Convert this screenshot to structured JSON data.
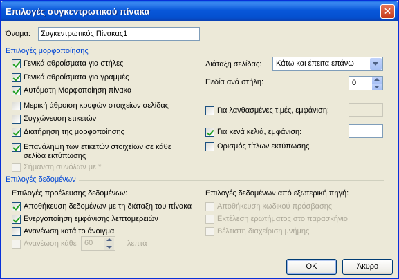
{
  "window": {
    "title": "Επιλογές συγκεντρωτικού πίνακα",
    "close_glyph": "✕"
  },
  "name": {
    "label": "Όνομα:",
    "value": "Συγκεντρωτικός Πίνακας1"
  },
  "format_section": {
    "title": "Επιλογές μορφοποίησης",
    "checkboxes": [
      {
        "label": "Γενικά αθροίσματα για στήλες",
        "checked": true
      },
      {
        "label": "Γενικά αθροίσματα για γραμμές",
        "checked": true
      },
      {
        "label": "Αυτόματη Μορφοποίηση πίνακα",
        "checked": true
      },
      {
        "label": "Μερική άθροιση κρυφών στοιχείων σελίδας",
        "checked": false
      },
      {
        "label": "Συγχώνευση ετικετών",
        "checked": false
      },
      {
        "label": "Διατήρηση της μορφοποίησης",
        "checked": true
      },
      {
        "label_line1": "Επανάληψη των ετικετών στοιχείων σε κάθε",
        "label_line2": "σελίδα εκτύπωσης",
        "checked": true
      },
      {
        "label": "Σήμανση συνόλων με *",
        "checked": false,
        "disabled": true
      }
    ],
    "page_layout": {
      "label": "Διάταξη σελίδας:",
      "value": "Κάτω και έπειτα επάνω"
    },
    "fields_per_column": {
      "label": "Πεδία ανά στήλη:",
      "value": "0"
    },
    "error_values": {
      "label": "Για λανθασμένες τιμές, εμφάνιση:",
      "checked": false,
      "value": ""
    },
    "empty_cells": {
      "label": "Για κενά κελιά, εμφάνιση:",
      "checked": true,
      "value": ""
    },
    "print_titles": {
      "label": "Ορισμός τίτλων εκτύπωσης",
      "checked": false
    }
  },
  "data_section": {
    "title": "Επιλογές δεδομένων",
    "source_title": "Επιλογές προέλευσης δεδομένων:",
    "source_checkboxes": [
      {
        "label": "Αποθήκευση δεδομένων με τη διάταξη του πίνακα",
        "checked": true
      },
      {
        "label": "Ενεργοποίηση εμφάνισης λεπτομερειών",
        "checked": true
      },
      {
        "label": "Ανανέωση κατά το άνοιγμα",
        "checked": false
      }
    ],
    "refresh_every": {
      "label": "Ανανέωση κάθε",
      "value": "60",
      "unit": "λεπτά",
      "checked": false,
      "disabled": true
    },
    "external_title": "Επιλογές δεδομένων από εξωτερική πηγή:",
    "external_checkboxes": [
      {
        "label": "Αποθήκευση κωδικού πρόσβασης",
        "checked": false,
        "disabled": true
      },
      {
        "label": "Εκτέλεση ερωτήματος στο παρασκήνιο",
        "checked": false,
        "disabled": true
      },
      {
        "label": "Βέλτιστη διαχείριση μνήμης",
        "checked": false,
        "disabled": true
      }
    ]
  },
  "buttons": {
    "ok": "OK",
    "cancel": "Άκυρο"
  }
}
